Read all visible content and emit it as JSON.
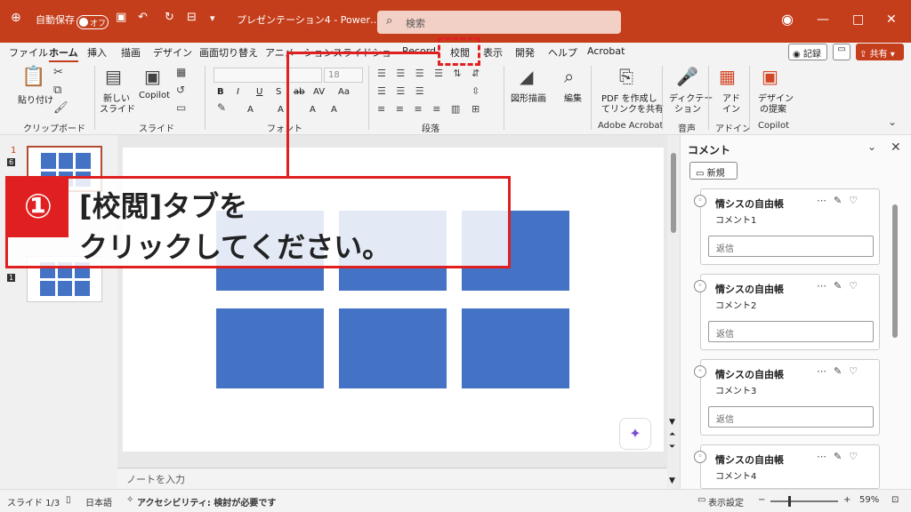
{
  "titlebar": {
    "autosave_label": "自動保存",
    "toggle_label": "オフ",
    "doc_title": "プレゼンテーション4 - Power…",
    "search_placeholder": "検索"
  },
  "menu": {
    "tabs": [
      "ファイル",
      "ホーム",
      "挿入",
      "描画",
      "デザイン",
      "画面切り替え",
      "アニメーション",
      "スライドショー",
      "Record",
      "校閲",
      "表示",
      "開発",
      "ヘルプ",
      "Acrobat"
    ],
    "active_tab": "ホーム",
    "record_label": "記録",
    "share_label": "共有"
  },
  "ribbon": {
    "paste_label": "貼り付け",
    "clipboard_group": "クリップボード",
    "new_slide_label": "新しい",
    "new_slide_label2": "スライド",
    "copilot_label": "Copilot",
    "slide_group": "スライド",
    "font_size": "18",
    "font_group": "フォント",
    "paragraph_group": "段落",
    "shape_label": "図形描画",
    "edit_label": "編集",
    "pdf_label1": "PDF を作成し",
    "pdf_label2": "てリンクを共有",
    "acrobat_group": "Adobe Acrobat",
    "dictate_label1": "ディクテー",
    "dictate_label2": "ション",
    "voice_group": "音声",
    "addin_label1": "アド",
    "addin_label2": "イン",
    "addin_group": "アドイン",
    "designer_label1": "デザイン",
    "designer_label2": "の提案",
    "copilot_group": "Copilot"
  },
  "slides_pane": {
    "slide1_number": "1",
    "slide1_comments": "6",
    "slide2_comments": "1"
  },
  "notes_placeholder": "ノートを入力",
  "comments": {
    "title": "コメント",
    "new_label": "新規",
    "items": [
      {
        "author": "情シスの自由帳",
        "body": "コメント1",
        "reply": "返信"
      },
      {
        "author": "情シスの自由帳",
        "body": "コメント2",
        "reply": "返信"
      },
      {
        "author": "情シスの自由帳",
        "body": "コメント3",
        "reply": "返信"
      },
      {
        "author": "情シスの自由帳",
        "body": "コメント4",
        "reply": ""
      }
    ]
  },
  "status": {
    "slide_info": "スライド 1/3",
    "language": "日本語",
    "accessibility": "アクセシビリティ: 検討が必要です",
    "display_settings": "表示設定",
    "zoom": "59%"
  },
  "callout": {
    "number": "①",
    "line1": "[校閲]タブを",
    "line2": "クリックしてください。"
  }
}
